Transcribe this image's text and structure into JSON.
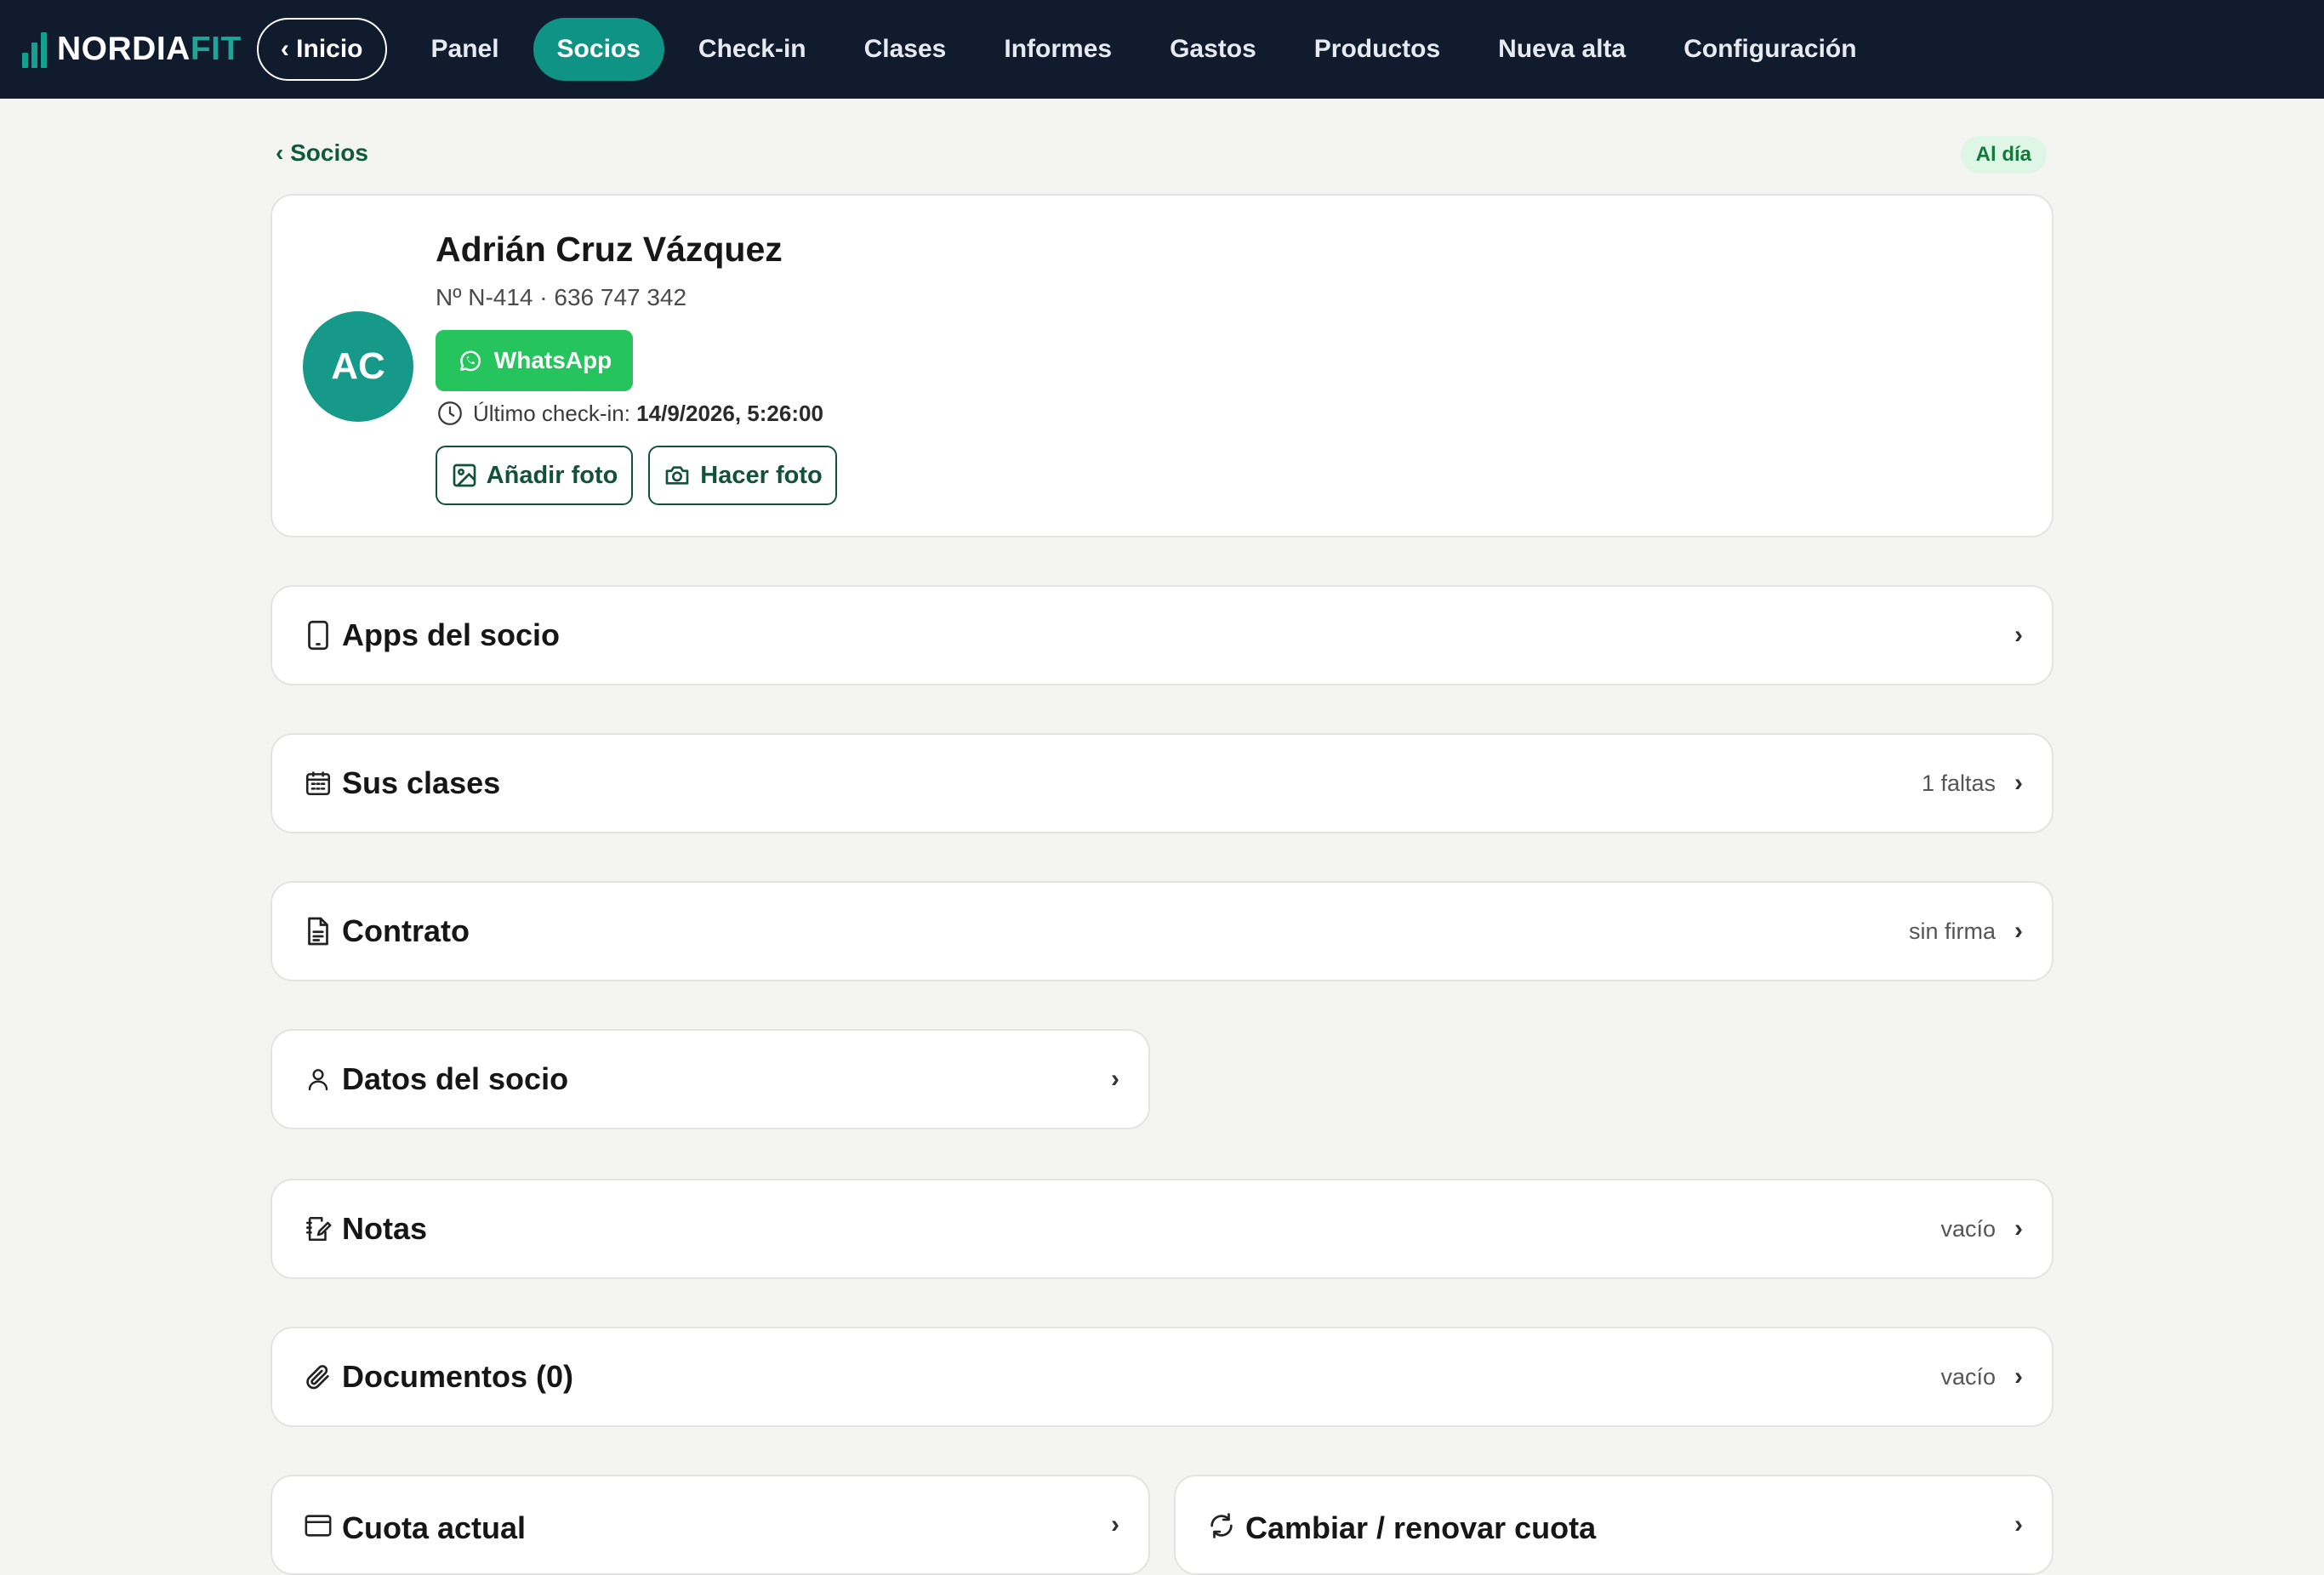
{
  "nav": {
    "brand_main": "NORDIA",
    "brand_accent": "FIT",
    "home_button": "‹ Inicio",
    "items": [
      {
        "label": "Panel",
        "active": false
      },
      {
        "label": "Socios",
        "active": true
      },
      {
        "label": "Check-in",
        "active": false
      },
      {
        "label": "Clases",
        "active": false
      },
      {
        "label": "Informes",
        "active": false
      },
      {
        "label": "Gastos",
        "active": false
      },
      {
        "label": "Productos",
        "active": false
      },
      {
        "label": "Nueva alta",
        "active": false
      },
      {
        "label": "Configuración",
        "active": false
      }
    ]
  },
  "breadcrumb": "‹ Socios",
  "status_badge": "Al día",
  "member": {
    "initials": "AC",
    "name": "Adrián Cruz Vázquez",
    "meta": "Nº N-414 · 636 747 342",
    "whatsapp_label": "WhatsApp",
    "last_checkin_label": "Último check-in:",
    "last_checkin_value": "14/9/2026, 5:26:00",
    "add_photo_label": "Añadir foto",
    "take_photo_label": "Hacer foto"
  },
  "sections": {
    "apps": {
      "label": "Apps del socio",
      "icon": "phone-icon",
      "status": ""
    },
    "classes": {
      "label": "Sus clases",
      "icon": "calendar-icon",
      "status": "1 faltas"
    },
    "contract": {
      "label": "Contrato",
      "icon": "document-icon",
      "status": "sin firma"
    },
    "details": {
      "label": "Datos del socio",
      "icon": "user-icon",
      "status": ""
    },
    "notes": {
      "label": "Notas",
      "icon": "notes-icon",
      "status": "vacío"
    },
    "documents": {
      "label": "Documentos (0)",
      "icon": "paperclip-icon",
      "status": "vacío"
    },
    "current_fee": {
      "label": "Cuota actual",
      "icon": "card-icon",
      "status": ""
    },
    "renew_fee": {
      "label": "Cambiar / renovar cuota",
      "icon": "refresh-icon",
      "status": ""
    }
  },
  "chevron": "›",
  "colors": {
    "nav_bg": "#111b2e",
    "accent_teal": "#0f9384",
    "whatsapp_green": "#25c45c",
    "dark_green": "#13523a",
    "status_bg": "#ddf6e6"
  }
}
